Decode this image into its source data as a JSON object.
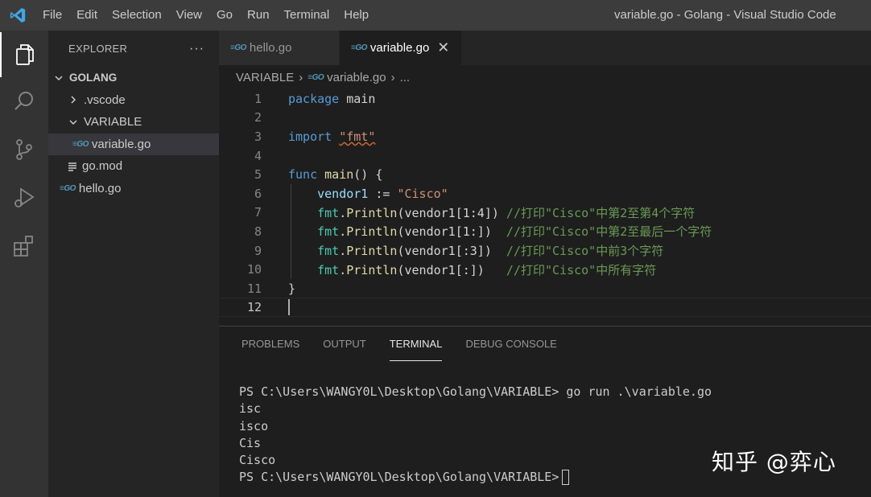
{
  "titlebar": {
    "menu": [
      "File",
      "Edit",
      "Selection",
      "View",
      "Go",
      "Run",
      "Terminal",
      "Help"
    ],
    "window_title": "variable.go - Golang - Visual Studio Code"
  },
  "activity_bar": {
    "items": [
      "explorer-icon",
      "search-icon",
      "source-control-icon",
      "run-debug-icon",
      "extensions-icon"
    ]
  },
  "sidebar": {
    "header": "EXPLORER",
    "more": "···",
    "root": "GOLANG",
    "items": [
      {
        "label": ".vscode",
        "type": "folder-collapsed"
      },
      {
        "label": "VARIABLE",
        "type": "folder-expanded"
      },
      {
        "label": "variable.go",
        "type": "go-file",
        "selected": true
      },
      {
        "label": "go.mod",
        "type": "mod-file"
      },
      {
        "label": "hello.go",
        "type": "go-file"
      }
    ]
  },
  "tabs": [
    {
      "label": "hello.go",
      "active": false
    },
    {
      "label": "variable.go",
      "active": true
    }
  ],
  "breadcrumb": {
    "folder": "VARIABLE",
    "file": "variable.go",
    "ellipsis": "..."
  },
  "editor": {
    "line_numbers": [
      "1",
      "2",
      "3",
      "4",
      "5",
      "6",
      "7",
      "8",
      "9",
      "10",
      "11",
      "12"
    ],
    "code": {
      "l1_kw": "package",
      "l1_name": "main",
      "l3_kw": "import",
      "l3_str": "\"fmt\"",
      "l5_kw": "func",
      "l5_fn": "main",
      "l5_rest": "() {",
      "l6_var": "vendor1",
      "l6_op": " := ",
      "l6_str": "\"Cisco\"",
      "pkg": "fmt",
      "println": "Println",
      "l7_args": "(vendor1[1:4])",
      "l7_cmt": " //打印\"Cisco\"中第2至第4个字符",
      "l8_args": "(vendor1[1:])",
      "l8_cmt": "  //打印\"Cisco\"中第2至最后一个字符",
      "l9_args": "(vendor1[:3])",
      "l9_cmt": "  //打印\"Cisco\"中前3个字符",
      "l10_args": "(vendor1[:])",
      "l10_cmt": "   //打印\"Cisco\"中所有字符",
      "l11": "}"
    }
  },
  "panel": {
    "tabs": [
      "PROBLEMS",
      "OUTPUT",
      "TERMINAL",
      "DEBUG CONSOLE"
    ],
    "active_tab": "TERMINAL",
    "terminal_lines": [
      "PS C:\\Users\\WANGY0L\\Desktop\\Golang\\VARIABLE> go run .\\variable.go",
      "isc",
      "isco",
      "Cis",
      "Cisco"
    ],
    "prompt": "PS C:\\Users\\WANGY0L\\Desktop\\Golang\\VARIABLE>"
  },
  "watermark": "知乎 @弈心",
  "colors": {
    "accent": "#007acc",
    "go_icon": "#519aba",
    "keyword": "#569cd6",
    "string": "#ce9178",
    "comment": "#6a9955"
  }
}
